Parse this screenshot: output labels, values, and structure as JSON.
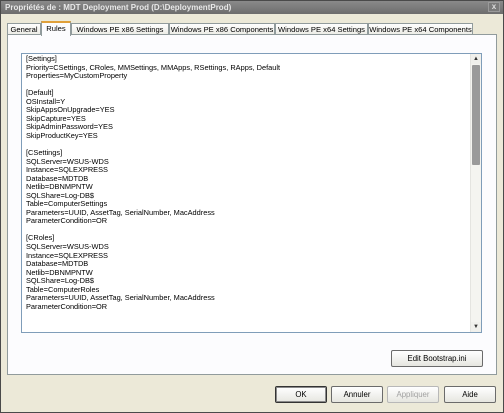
{
  "window": {
    "title": "Propriétés de : MDT Deployment Prod (D:\\DeploymentProd)",
    "close_glyph": "x"
  },
  "tabs": [
    {
      "label": "General",
      "active": false
    },
    {
      "label": "Rules",
      "active": true
    },
    {
      "label": "Windows PE x86 Settings",
      "active": false
    },
    {
      "label": "Windows PE x86 Components",
      "active": false
    },
    {
      "label": "Windows PE x64 Settings",
      "active": false
    },
    {
      "label": "Windows PE x64 Components",
      "active": false
    }
  ],
  "rules_text": "[Settings]\nPriority=CSettings, CRoles, MMSettings, MMApps, RSettings, RApps, Default\nProperties=MyCustomProperty\n\n[Default]\nOSInstall=Y\nSkipAppsOnUpgrade=YES\nSkipCapture=YES\nSkipAdminPassword=YES\nSkipProductKey=YES\n\n[CSettings]\nSQLServer=WSUS-WDS\nInstance=SQLEXPRESS\nDatabase=MDTDB\nNetlib=DBNMPNTW\nSQLShare=Log-DB$\nTable=ComputerSettings\nParameters=UUID, AssetTag, SerialNumber, MacAddress\nParameterCondition=OR\n\n[CRoles]\nSQLServer=WSUS-WDS\nInstance=SQLEXPRESS\nDatabase=MDTDB\nNetlib=DBNMPNTW\nSQLShare=Log-DB$\nTable=ComputerRoles\nParameters=UUID, AssetTag, SerialNumber, MacAddress\nParameterCondition=OR",
  "buttons": {
    "edit_bootstrap": "Edit Bootstrap.ini",
    "ok": "OK",
    "cancel": "Annuler",
    "apply": "Appliquer",
    "help": "Aide"
  },
  "icons": {
    "scroll_up": "▲",
    "scroll_down": "▼"
  }
}
